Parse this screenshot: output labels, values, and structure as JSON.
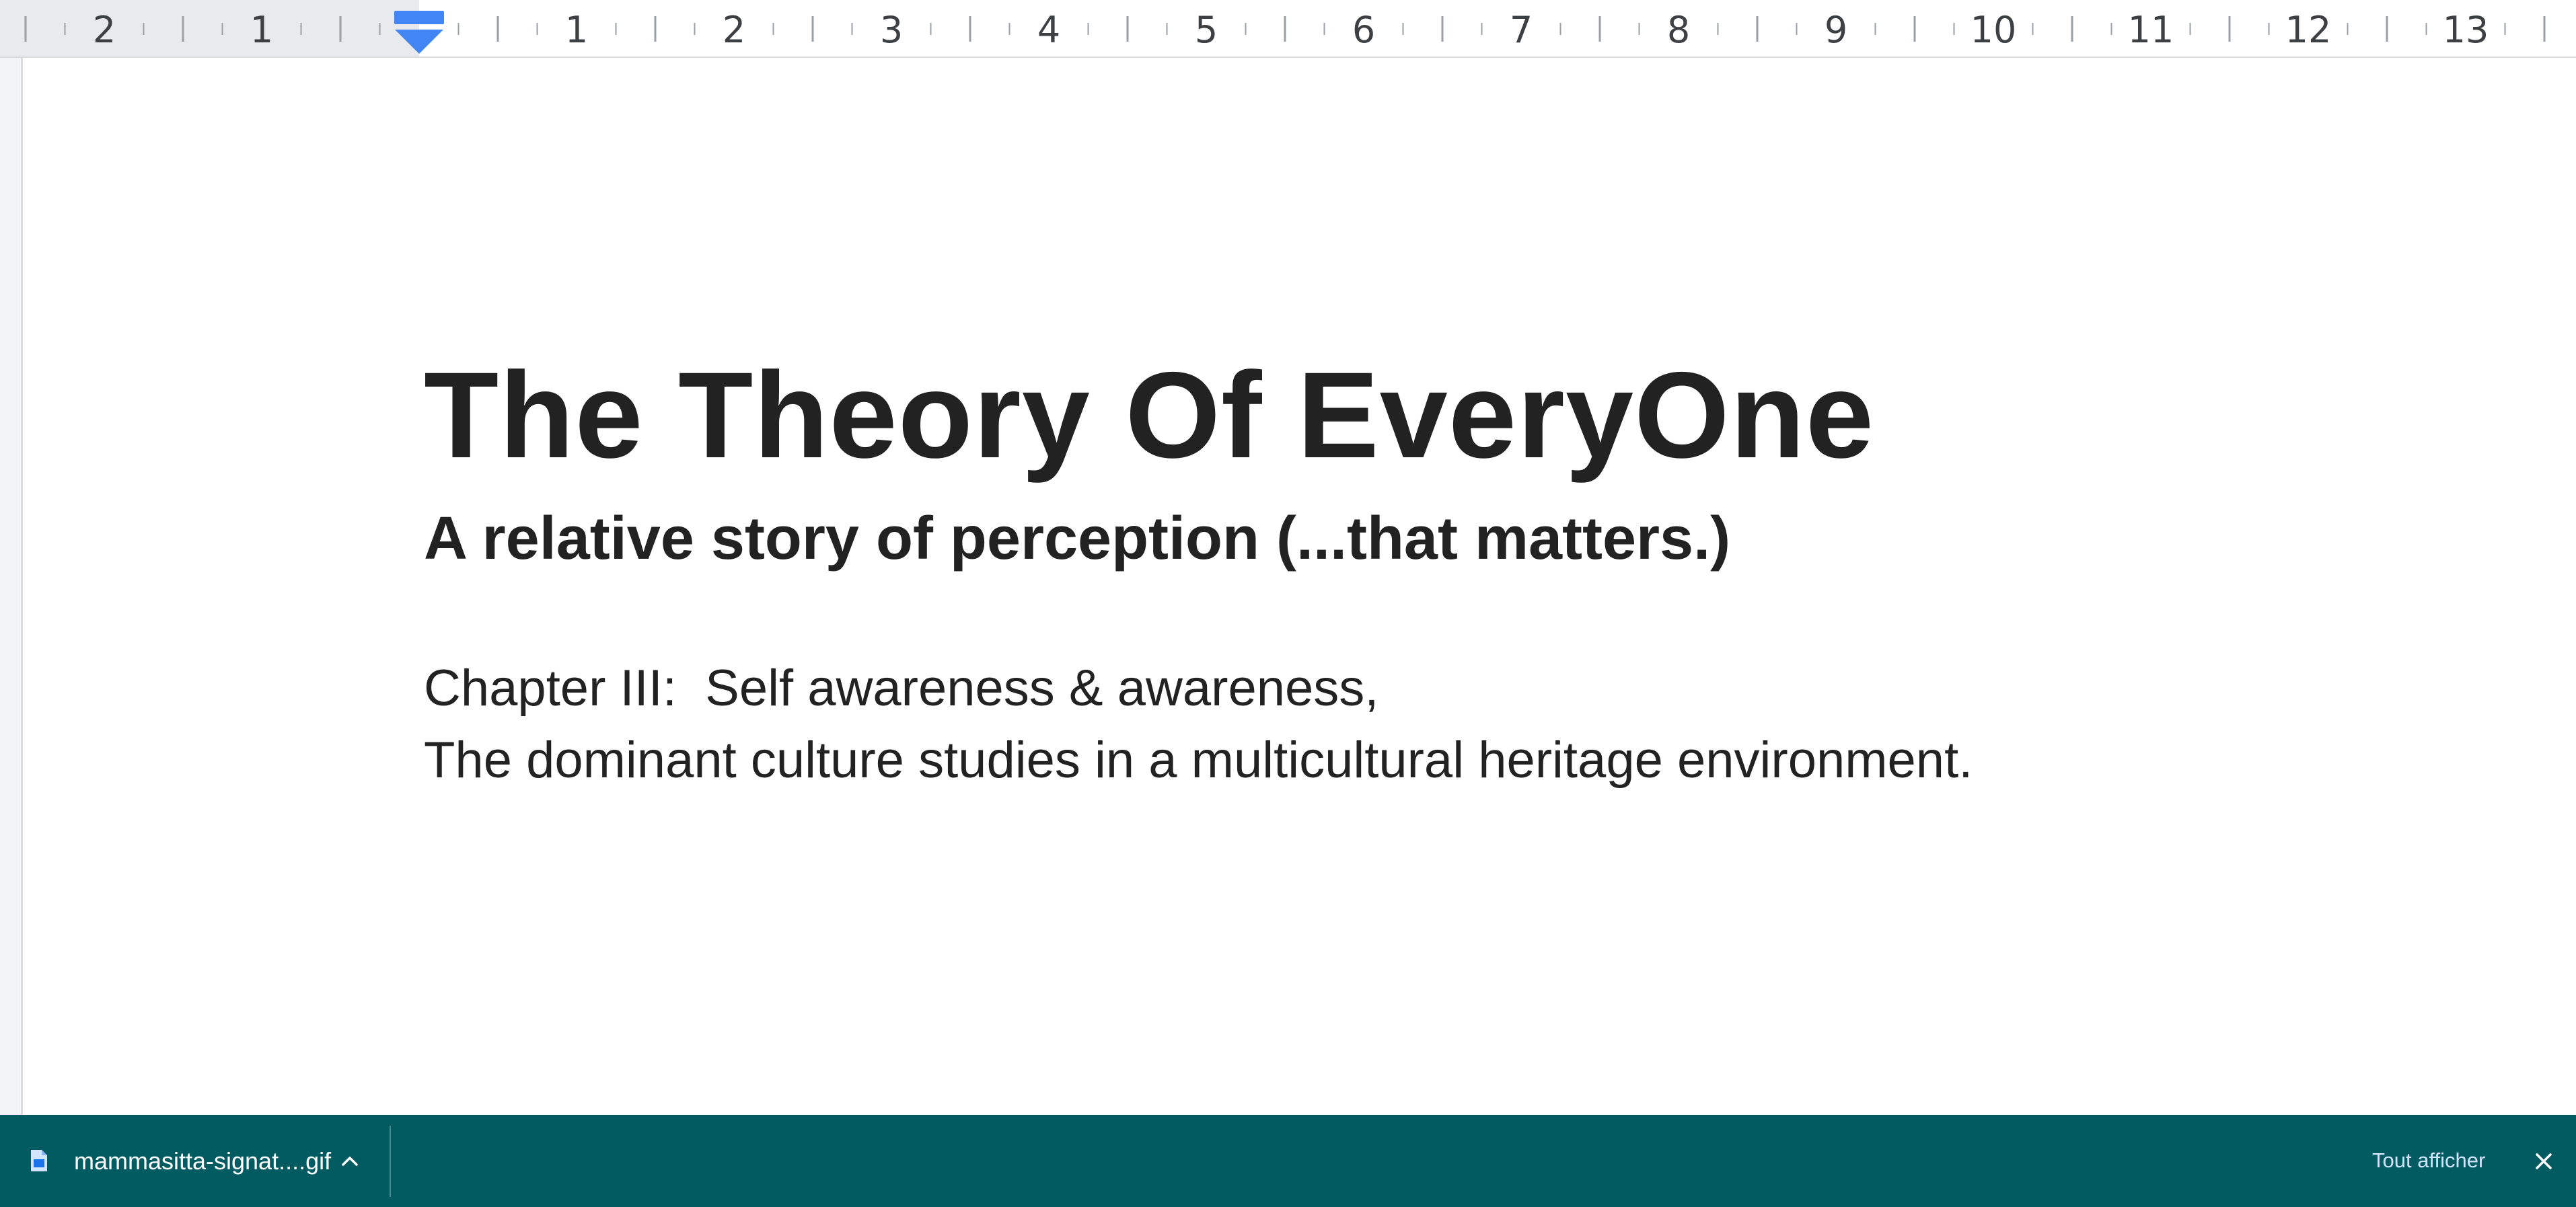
{
  "ruler": {
    "labels": [
      "2",
      "1",
      "1",
      "2",
      "3",
      "4",
      "5",
      "6",
      "7",
      "8",
      "9",
      "10",
      "11",
      "12",
      "13"
    ]
  },
  "document": {
    "title": "The Theory Of EveryOne",
    "subtitle": "A relative story of perception (...that matters.)",
    "line1": "Chapter III:  Self awareness & awareness,",
    "line2": "The dominant culture studies in a multicultural heritage environment."
  },
  "download_bar": {
    "file_name": "mammasitta-signat....gif",
    "show_all_label": "Tout afficher",
    "background_color": "#035b62"
  },
  "colors": {
    "indent_marker": "#4285f4",
    "text": "#222222"
  },
  "icons": {
    "file": "file-icon",
    "chevron": "chevron-up-icon",
    "close": "close-icon",
    "indent": "indent-marker-icon"
  }
}
